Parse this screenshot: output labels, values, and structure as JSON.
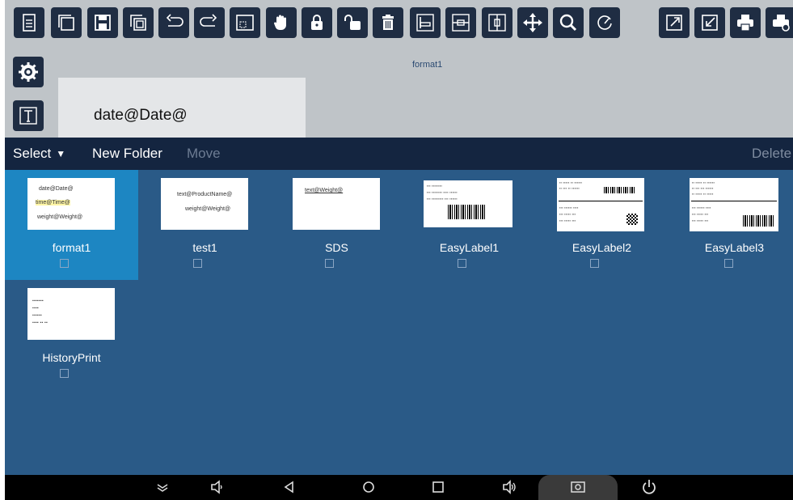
{
  "toolbar": {
    "buttons": [
      {
        "name": "new-file-icon"
      },
      {
        "name": "copy-icon"
      },
      {
        "name": "save-icon"
      },
      {
        "name": "save-as-icon"
      },
      {
        "name": "undo-icon"
      },
      {
        "name": "redo-icon"
      },
      {
        "name": "select-area-icon"
      },
      {
        "name": "hand-icon"
      },
      {
        "name": "lock-icon"
      },
      {
        "name": "unlock-icon"
      },
      {
        "name": "trash-icon"
      },
      {
        "name": "align-left-icon"
      },
      {
        "name": "align-center-horizontal-icon"
      },
      {
        "name": "align-center-vertical-icon"
      },
      {
        "name": "move-icon"
      },
      {
        "name": "zoom-icon"
      },
      {
        "name": "rotate-icon"
      },
      {
        "name": "export-icon"
      },
      {
        "name": "import-icon"
      },
      {
        "name": "print-icon"
      },
      {
        "name": "print-settings-icon"
      }
    ]
  },
  "side_tools": [
    {
      "name": "settings-gear-icon"
    },
    {
      "name": "text-tool-icon"
    }
  ],
  "editor": {
    "format_name": "format1",
    "canvas_text": "date@Date@"
  },
  "action_bar": {
    "select_label": "Select",
    "new_folder_label": "New Folder",
    "move_label": "Move",
    "delete_label": "Delete"
  },
  "files": [
    {
      "name": "format1",
      "selected": true,
      "lines": [
        "date@Date@",
        "time@Time@",
        "weight@Weight@"
      ]
    },
    {
      "name": "test1",
      "selected": false,
      "lines": [
        "text@ProductName@",
        "weight@Weight@"
      ]
    },
    {
      "name": "SDS",
      "selected": false,
      "lines": [
        "text@Weight@"
      ]
    },
    {
      "name": "EasyLabel1",
      "selected": false
    },
    {
      "name": "EasyLabel2",
      "selected": false
    },
    {
      "name": "EasyLabel3",
      "selected": false
    },
    {
      "name": "HistoryPrint",
      "selected": false
    }
  ],
  "nav_bar": {
    "buttons": [
      "collapse-icon",
      "volume-down-icon",
      "back-icon",
      "home-icon",
      "recents-icon",
      "volume-up-icon",
      "screenshot-icon",
      "power-icon"
    ]
  },
  "colors": {
    "toolbar_button": "#1f2d43",
    "editor_background": "#bfc4c8",
    "action_bar": "#142540",
    "file_grid": "#2a5a87",
    "selected_tile": "#1d86c2"
  }
}
